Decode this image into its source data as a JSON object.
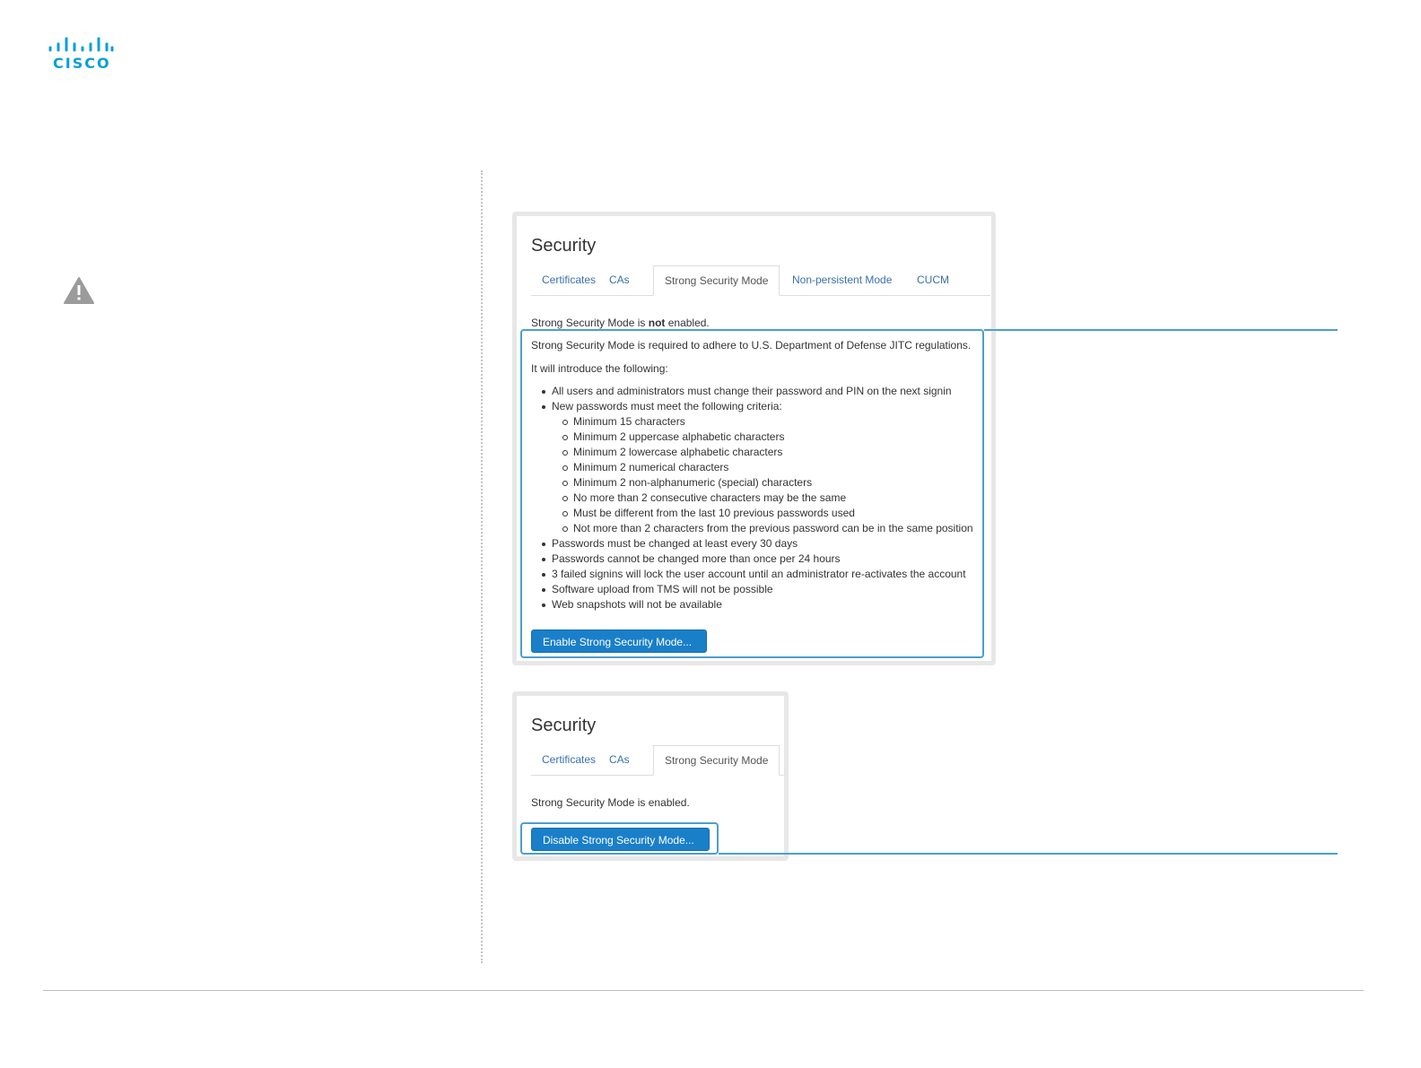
{
  "logo": {
    "text": "CISCO",
    "icon": "cisco-logo-icon",
    "color": "#049fd9"
  },
  "warning_icon": "warning-triangle-icon",
  "panel_disabled": {
    "title": "Security",
    "tabs": [
      {
        "label": "Certificates",
        "active": false
      },
      {
        "label": "CAs",
        "active": false
      },
      {
        "label": "Strong Security Mode",
        "active": true
      },
      {
        "label": "Non-persistent Mode",
        "active": false
      },
      {
        "label": "CUCM",
        "active": false
      }
    ],
    "status_prefix": "Strong Security Mode is ",
    "status_emphasis": "not",
    "status_suffix": " enabled.",
    "intro": "Strong Security Mode is required to adhere to U.S. Department of Defense JITC regulations.",
    "lead": "It will introduce the following:",
    "items": [
      {
        "text": "All users and administrators must change their password and PIN on the next signin",
        "level": 1
      },
      {
        "text": "New passwords must meet the following criteria:",
        "level": 1
      },
      {
        "text": "Minimum 15 characters",
        "level": 2
      },
      {
        "text": "Minimum 2 uppercase alphabetic characters",
        "level": 2
      },
      {
        "text": "Minimum 2 lowercase alphabetic characters",
        "level": 2
      },
      {
        "text": "Minimum 2 numerical characters",
        "level": 2
      },
      {
        "text": "Minimum 2 non-alphanumeric (special) characters",
        "level": 2
      },
      {
        "text": "No more than 2 consecutive characters may be the same",
        "level": 2
      },
      {
        "text": "Must be different from the last 10 previous passwords used",
        "level": 2
      },
      {
        "text": "Not more than 2 characters from the previous password can be in the same position",
        "level": 2
      },
      {
        "text": "Passwords must be changed at least every 30 days",
        "level": 1
      },
      {
        "text": "Passwords cannot be changed more than once per 24 hours",
        "level": 1
      },
      {
        "text": "3 failed signins will lock the user account until an administrator re-activates the account",
        "level": 1
      },
      {
        "text": "Software upload from TMS will not be possible",
        "level": 1
      },
      {
        "text": "Web snapshots will not be available",
        "level": 1
      }
    ],
    "button": "Enable Strong Security Mode..."
  },
  "panel_enabled": {
    "title": "Security",
    "tabs": [
      {
        "label": "Certificates",
        "active": false
      },
      {
        "label": "CAs",
        "active": false
      },
      {
        "label": "Strong Security Mode",
        "active": true
      }
    ],
    "status": "Strong Security Mode is enabled.",
    "button": "Disable Strong Security Mode..."
  },
  "colors": {
    "accent": "#4a9fd0",
    "button": "#1a7fc9",
    "tab_link": "#3a6fae"
  }
}
